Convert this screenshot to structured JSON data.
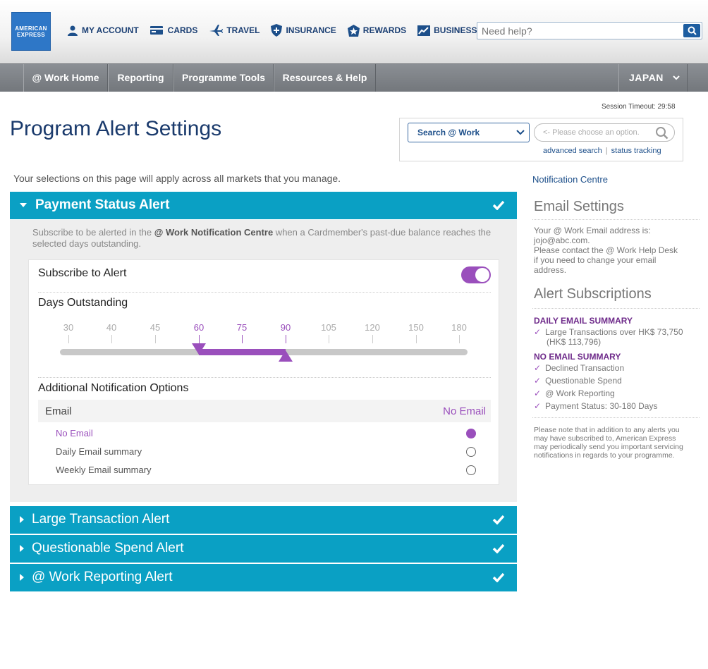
{
  "header": {
    "logo_text": "AMERICAN EXPRESS",
    "nav": [
      {
        "label": "MY ACCOUNT",
        "icon": "user-icon"
      },
      {
        "label": "CARDS",
        "icon": "card-icon"
      },
      {
        "label": "TRAVEL",
        "icon": "plane-icon"
      },
      {
        "label": "INSURANCE",
        "icon": "shield-icon"
      },
      {
        "label": "REWARDS",
        "icon": "star-badge-icon"
      },
      {
        "label": "BUSINESS",
        "icon": "chart-icon"
      }
    ],
    "help_placeholder": "Need help?"
  },
  "navbar": {
    "items": [
      "@ Work Home",
      "Reporting",
      "Programme Tools",
      "Resources & Help"
    ],
    "country": "JAPAN"
  },
  "session_timeout": "Session Timeout: 29:58",
  "page_title": "Program Alert Settings",
  "search_work": {
    "selected": "Search @ Work",
    "placeholder": "<- Please choose an option.",
    "advanced_search": "advanced search",
    "status_tracking": "status tracking"
  },
  "intro": "Your selections on this page will apply across all markets that you manage.",
  "payment_alert": {
    "title": "Payment Status Alert",
    "desc_before": "Subscribe to be alerted in the ",
    "desc_bold": "@ Work Notification Centre",
    "desc_after": " when a Cardmember's past-due balance reaches the selected days outstanding.",
    "subscribe_label": "Subscribe to Alert",
    "subscribed": true,
    "days_label": "Days Outstanding",
    "days_ticks": [
      "30",
      "40",
      "45",
      "60",
      "75",
      "90",
      "105",
      "120",
      "150",
      "180"
    ],
    "range_from": "60",
    "range_to": "90",
    "additional_label": "Additional Notification Options",
    "email_label": "Email",
    "email_value": "No Email",
    "options": [
      "No Email",
      "Daily Email summary",
      "Weekly Email summary"
    ],
    "selected_option": "No Email"
  },
  "collapsed_alerts": [
    "Large Transaction Alert",
    "Questionable Spend Alert",
    "@ Work Reporting Alert"
  ],
  "sidebar": {
    "notification_centre": "Notification Centre",
    "email_settings_title": "Email Settings",
    "email_text_1": "Your @ Work Email address is:",
    "email_address": "jojo@abc.com.",
    "email_text_2": "Please contact the @ Work Help Desk",
    "email_text_3": "if you need to change your email",
    "email_text_4": "address.",
    "subscriptions_title": "Alert Subscriptions",
    "daily_title": "DAILY EMAIL SUMMARY",
    "daily_items": [
      "Large Transactions over HK$ 73,750",
      "(HK$ 113,796)"
    ],
    "no_email_title": "NO EMAIL SUMMARY",
    "no_email_items": [
      "Declined Transaction",
      "Questionable Spend",
      "@ Work Reporting",
      "Payment Status: 30-180 Days"
    ],
    "note": "Please note that in addition to any alerts you may have subscribed to, American Express may periodically send you important servicing notifications in regards to your programme."
  },
  "colors": {
    "accent": "#0aa0c4",
    "purple": "#9a4fbc",
    "navy": "#1a3a6c"
  }
}
